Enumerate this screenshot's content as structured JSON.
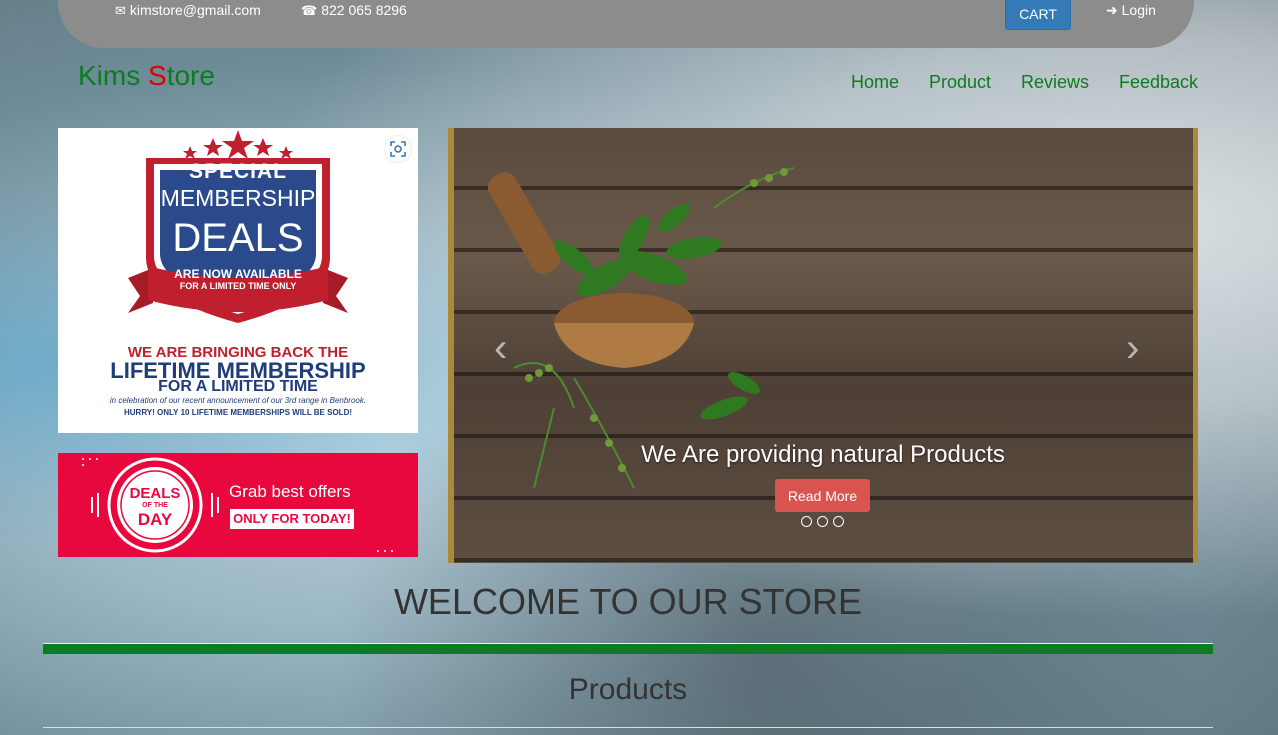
{
  "topbar": {
    "email": "kimstore@gmail.com",
    "phone": "822 065 8296",
    "cart_label": "CART",
    "login_label": "Login"
  },
  "brand": {
    "part1": "Kims ",
    "part2": "S",
    "part3": "tore"
  },
  "nav": {
    "items": [
      "Home",
      "Product",
      "Reviews",
      "Feedback"
    ]
  },
  "promo_membership": {
    "line1": "SPECIAL",
    "line2": "MEMBERSHIP",
    "line3": "DEALS",
    "ribbon1": "ARE NOW AVAILABLE",
    "ribbon2": "FOR A LIMITED TIME ONLY",
    "text1": "WE ARE BRINGING BACK THE",
    "text2": "LIFETIME MEMBERSHIP",
    "text3": "FOR A LIMITED TIME",
    "text4": "in celebration of our recent announcement of our 3rd range in Benbrook.",
    "text5": "HURRY! ONLY 10 LIFETIME MEMBERSHIPS WILL BE SOLD!"
  },
  "promo_deals": {
    "badge1": "DEALS",
    "badge2": "OF THE",
    "badge3": "DAY",
    "headline": "Grab best offers",
    "sub": "ONLY FOR TODAY!"
  },
  "carousel": {
    "caption": "We Are providing natural Products",
    "button": "Read More",
    "prev_icon": "chevron-left-icon",
    "next_icon": "chevron-right-icon"
  },
  "sections": {
    "welcome": "WELCOME TO OUR STORE",
    "products": "Products"
  },
  "colors": {
    "brand_green": "#0a7d1e",
    "brand_red": "#e00000",
    "cart_blue": "#337ab7",
    "read_more_red": "#d9534f",
    "deals_red": "#e8083e"
  }
}
